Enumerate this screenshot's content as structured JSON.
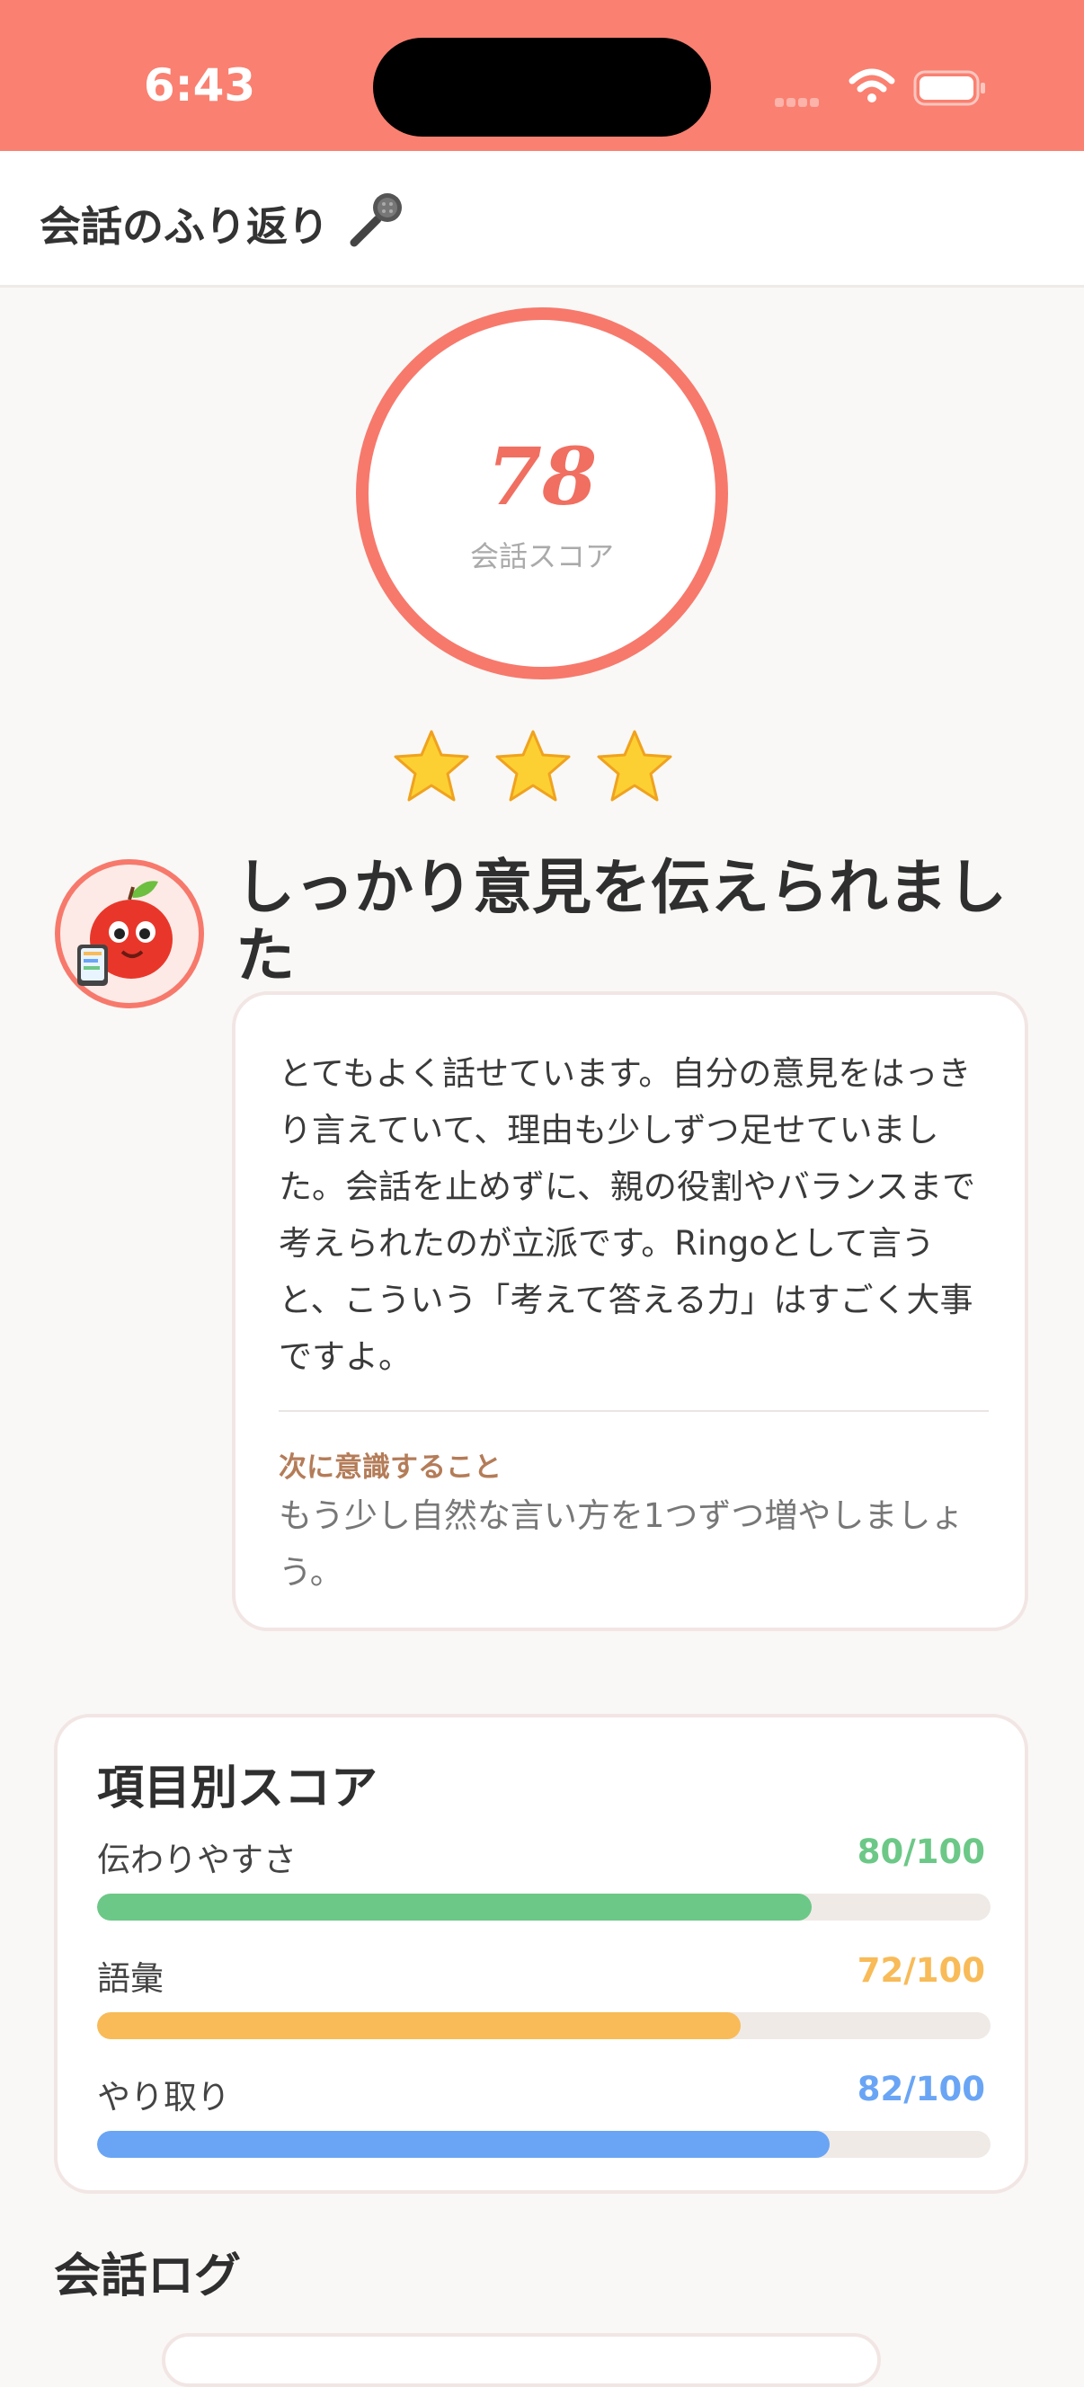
{
  "status": {
    "time": "6:43"
  },
  "header": {
    "title": "会話のふり返り",
    "icon": "microphone-icon"
  },
  "score": {
    "value": "78",
    "label": "会話スコア",
    "ring_color": "#f7796c"
  },
  "stars": {
    "count": 3,
    "icon": "star-icon"
  },
  "feedback": {
    "headline": "しっかり意見を伝えられました",
    "body": "とてもよく話せています。自分の意見をはっきり言えていて、理由も少しずつ足せていました。会話を止めずに、親の役割やバランスまで考えられたのが立派です。Ringoとして言うと、こういう「考えて答える力」はすごく大事ですよ。",
    "next_label": "次に意識すること",
    "next_text": "もう少し自然な言い方を1つずつ増やしましょう。"
  },
  "scores": {
    "title": "項目別スコア",
    "items": [
      {
        "label": "伝わりやすさ",
        "value": "80/100",
        "score": 80,
        "color": "#6cc887"
      },
      {
        "label": "語彙",
        "value": "72/100",
        "score": 72,
        "color": "#f8bb58"
      },
      {
        "label": "やり取り",
        "value": "82/100",
        "score": 82,
        "color": "#6aa5f5"
      }
    ]
  },
  "log": {
    "title": "会話ログ"
  },
  "colors": {
    "accent": "#fa8071",
    "background": "#f9f8f6"
  }
}
